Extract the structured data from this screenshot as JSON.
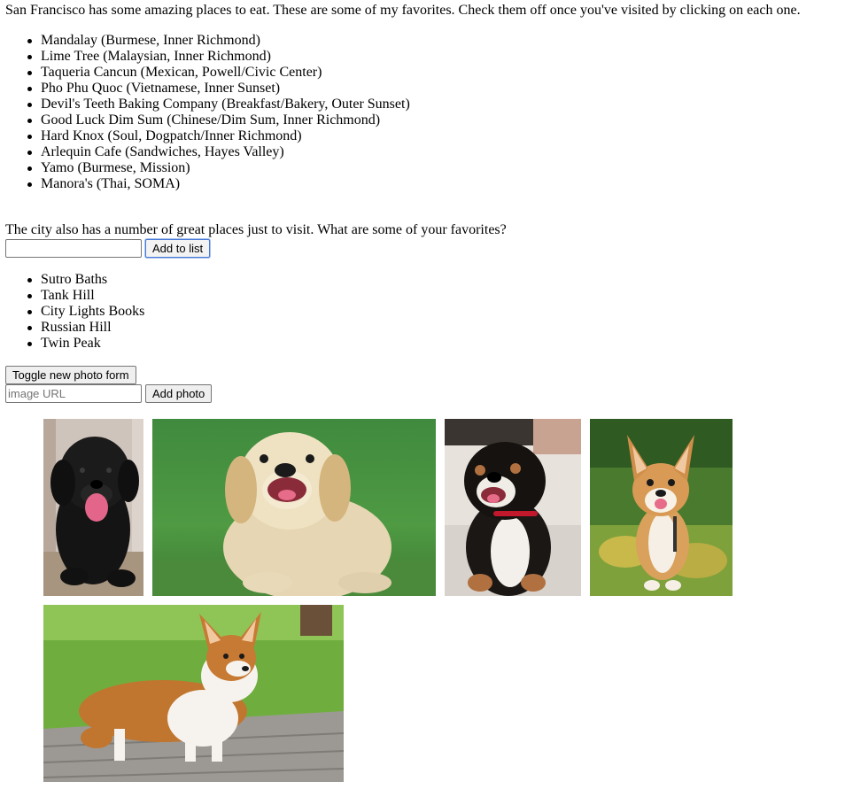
{
  "intro": "San Francisco has some amazing places to eat. These are some of my favorites. Check them off once you've visited by clicking on each one.",
  "restaurants": [
    "Mandalay (Burmese, Inner Richmond)",
    "Lime Tree (Malaysian, Inner Richmond)",
    "Taqueria Cancun (Mexican, Powell/Civic Center)",
    "Pho Phu Quoc (Vietnamese, Inner Sunset)",
    "Devil's Teeth Baking Company (Breakfast/Bakery, Outer Sunset)",
    "Good Luck Dim Sum (Chinese/Dim Sum, Inner Richmond)",
    "Hard Knox (Soul, Dogpatch/Inner Richmond)",
    "Arlequin Cafe (Sandwiches, Hayes Valley)",
    "Yamo (Burmese, Mission)",
    "Manora's (Thai, SOMA)"
  ],
  "visit_prompt": "The city also has a number of great places just to visit. What are some of your favorites?",
  "place_form": {
    "input_value": "",
    "input_placeholder": "",
    "add_button_label": "Add to list"
  },
  "places": [
    "Sutro Baths",
    "Tank Hill",
    "City Lights Books",
    "Russian Hill",
    "Twin Peak"
  ],
  "photo_form": {
    "toggle_button_label": "Toggle new photo form",
    "url_placeholder": "image URL",
    "url_value": "",
    "add_button_label": "Add photo"
  },
  "photos": [
    {
      "subject": "black-puppy-photo"
    },
    {
      "subject": "golden-retriever-puppy-photo"
    },
    {
      "subject": "bernese-puppy-photo"
    },
    {
      "subject": "corgi-puppy-grass-photo"
    },
    {
      "subject": "corgi-deck-photo"
    }
  ]
}
